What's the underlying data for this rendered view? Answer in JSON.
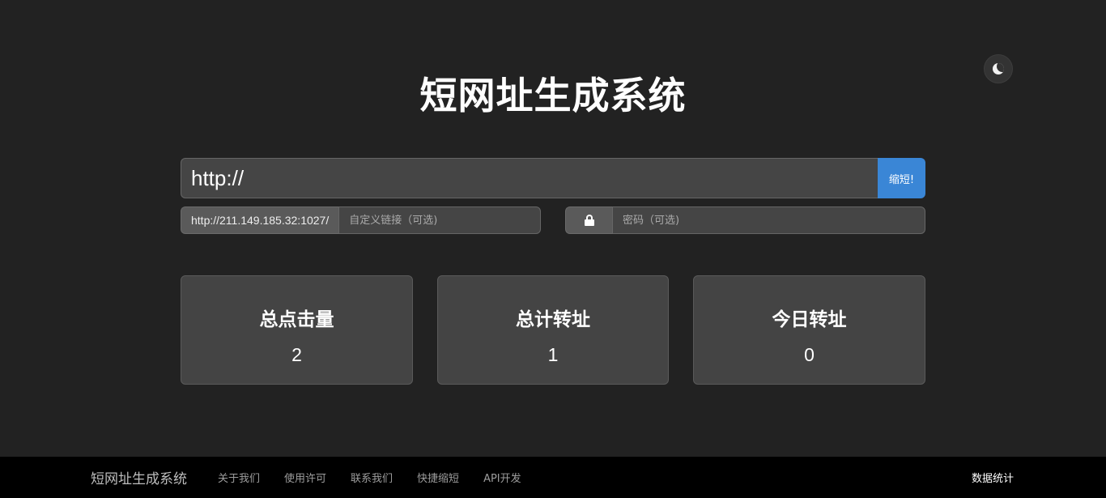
{
  "theme_toggle": {
    "icon": "moon-icon"
  },
  "title": "短网址生成系统",
  "url_form": {
    "url_value": "http://",
    "shorten_label": "缩短!",
    "base_url": "http://211.149.185.32:1027/",
    "custom_placeholder": "自定义链接（可选)",
    "password_placeholder": "密码（可选)",
    "lock_icon": "lock-icon"
  },
  "stats": [
    {
      "label": "总点击量",
      "value": "2"
    },
    {
      "label": "总计转址",
      "value": "1"
    },
    {
      "label": "今日转址",
      "value": "0"
    }
  ],
  "footer": {
    "brand": "短网址生成系统",
    "nav": [
      "关于我们",
      "使用许可",
      "联系我们",
      "快捷缩短",
      "API开发"
    ],
    "stats_link": "数据统计"
  },
  "colors": {
    "background": "#222222",
    "accent": "#3a86d6",
    "footer": "#000000"
  }
}
